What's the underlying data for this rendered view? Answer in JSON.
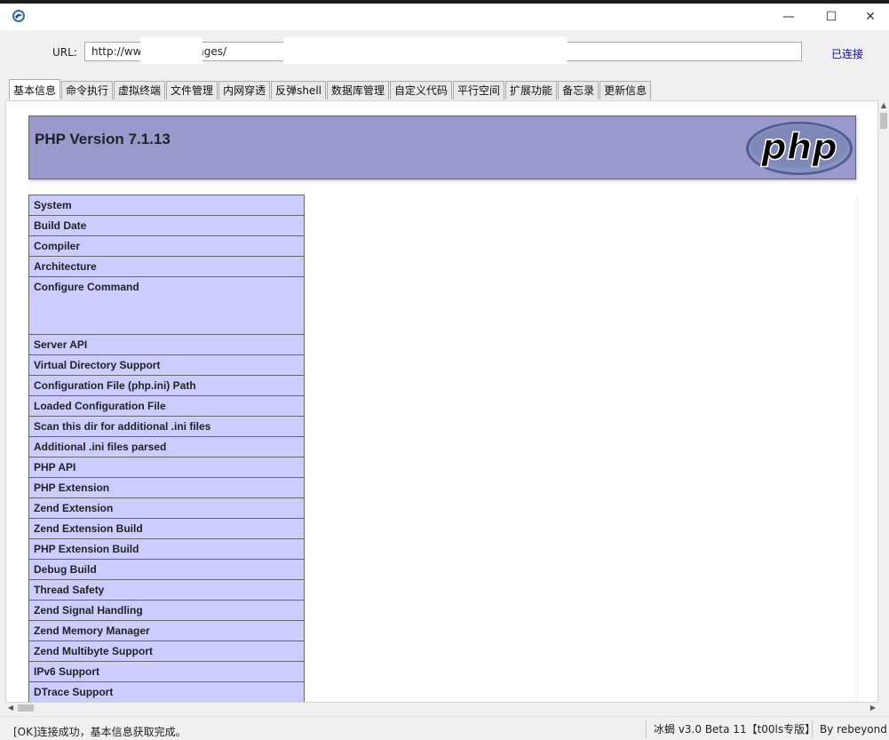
{
  "window": {
    "controls": {
      "minimize": "—",
      "maximize": "☐",
      "close": "✕"
    }
  },
  "url_bar": {
    "label": "URL:",
    "value": "http://ww                     /public/images/",
    "status": "已连接"
  },
  "tabs": [
    {
      "label": "基本信息",
      "active": true
    },
    {
      "label": "命令执行"
    },
    {
      "label": "虚拟终端"
    },
    {
      "label": "文件管理"
    },
    {
      "label": "内网穿透"
    },
    {
      "label": "反弹shell"
    },
    {
      "label": "数据库管理"
    },
    {
      "label": "自定义代码"
    },
    {
      "label": "平行空间"
    },
    {
      "label": "扩展功能"
    },
    {
      "label": "备忘录"
    },
    {
      "label": "更新信息"
    }
  ],
  "phpinfo": {
    "title": "PHP Version 7.1.13",
    "logo_text": "php",
    "rows": [
      "System",
      "Build Date",
      "Compiler",
      "Architecture",
      "Configure Command",
      "Server API",
      "Virtual Directory Support",
      "Configuration File (php.ini) Path",
      "Loaded Configuration File",
      "Scan this dir for additional .ini files",
      "Additional .ini files parsed",
      "PHP API",
      "PHP Extension",
      "Zend Extension",
      "Zend Extension Build",
      "PHP Extension Build",
      "Debug Build",
      "Thread Safety",
      "Zend Signal Handling",
      "Zend Memory Manager",
      "Zend Multibyte Support",
      "IPv6 Support",
      "DTrace Support"
    ]
  },
  "statusbar": {
    "message": "[OK]连接成功，基本信息获取完成。",
    "version": "冰蝎 v3.0 Beta 11【t00ls专版】",
    "author": "By rebeyond"
  },
  "colors": {
    "php_header_bg": "#9999cc",
    "php_key_bg": "#ccccff",
    "link": "#0000ee"
  }
}
